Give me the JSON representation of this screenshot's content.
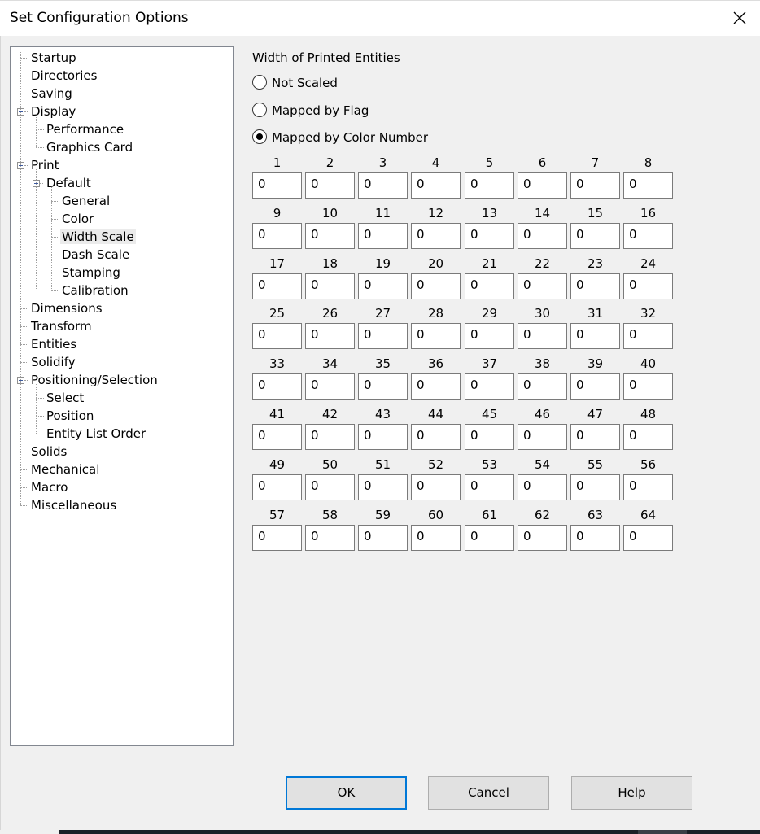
{
  "window": {
    "title": "Set Configuration Options",
    "close_icon": "close-icon"
  },
  "tree": {
    "selected": "Width Scale",
    "items": [
      {
        "label": "Startup",
        "level": 0
      },
      {
        "label": "Directories",
        "level": 0
      },
      {
        "label": "Saving",
        "level": 0
      },
      {
        "label": "Display",
        "level": 0,
        "expanded": true
      },
      {
        "label": "Performance",
        "level": 1
      },
      {
        "label": "Graphics Card",
        "level": 1
      },
      {
        "label": "Print",
        "level": 0,
        "expanded": true
      },
      {
        "label": "Default",
        "level": 1,
        "expanded": true
      },
      {
        "label": "General",
        "level": 2
      },
      {
        "label": "Color",
        "level": 2
      },
      {
        "label": "Width Scale",
        "level": 2
      },
      {
        "label": "Dash Scale",
        "level": 2
      },
      {
        "label": "Stamping",
        "level": 2
      },
      {
        "label": "Calibration",
        "level": 2
      },
      {
        "label": "Dimensions",
        "level": 0
      },
      {
        "label": "Transform",
        "level": 0
      },
      {
        "label": "Entities",
        "level": 0
      },
      {
        "label": "Solidify",
        "level": 0
      },
      {
        "label": "Positioning/Selection",
        "level": 0,
        "expanded": true
      },
      {
        "label": "Select",
        "level": 1
      },
      {
        "label": "Position",
        "level": 1
      },
      {
        "label": "Entity List Order",
        "level": 1
      },
      {
        "label": "Solids",
        "level": 0
      },
      {
        "label": "Mechanical",
        "level": 0
      },
      {
        "label": "Macro",
        "level": 0
      },
      {
        "label": "Miscellaneous",
        "level": 0
      }
    ]
  },
  "panel": {
    "group_label": "Width of Printed Entities",
    "radios": [
      {
        "label": "Not Scaled",
        "checked": false
      },
      {
        "label": "Mapped by Flag",
        "checked": false
      },
      {
        "label": "Mapped by Color Number",
        "checked": true
      }
    ],
    "color_widths": [
      {
        "n": "1",
        "v": "0"
      },
      {
        "n": "2",
        "v": "0"
      },
      {
        "n": "3",
        "v": "0"
      },
      {
        "n": "4",
        "v": "0"
      },
      {
        "n": "5",
        "v": "0"
      },
      {
        "n": "6",
        "v": "0"
      },
      {
        "n": "7",
        "v": "0"
      },
      {
        "n": "8",
        "v": "0"
      },
      {
        "n": "9",
        "v": "0"
      },
      {
        "n": "10",
        "v": "0"
      },
      {
        "n": "11",
        "v": "0"
      },
      {
        "n": "12",
        "v": "0"
      },
      {
        "n": "13",
        "v": "0"
      },
      {
        "n": "14",
        "v": "0"
      },
      {
        "n": "15",
        "v": "0"
      },
      {
        "n": "16",
        "v": "0"
      },
      {
        "n": "17",
        "v": "0"
      },
      {
        "n": "18",
        "v": "0"
      },
      {
        "n": "19",
        "v": "0"
      },
      {
        "n": "20",
        "v": "0"
      },
      {
        "n": "21",
        "v": "0"
      },
      {
        "n": "22",
        "v": "0"
      },
      {
        "n": "23",
        "v": "0"
      },
      {
        "n": "24",
        "v": "0"
      },
      {
        "n": "25",
        "v": "0"
      },
      {
        "n": "26",
        "v": "0"
      },
      {
        "n": "27",
        "v": "0"
      },
      {
        "n": "28",
        "v": "0"
      },
      {
        "n": "29",
        "v": "0"
      },
      {
        "n": "30",
        "v": "0"
      },
      {
        "n": "31",
        "v": "0"
      },
      {
        "n": "32",
        "v": "0"
      },
      {
        "n": "33",
        "v": "0"
      },
      {
        "n": "34",
        "v": "0"
      },
      {
        "n": "35",
        "v": "0"
      },
      {
        "n": "36",
        "v": "0"
      },
      {
        "n": "37",
        "v": "0"
      },
      {
        "n": "38",
        "v": "0"
      },
      {
        "n": "39",
        "v": "0"
      },
      {
        "n": "40",
        "v": "0"
      },
      {
        "n": "41",
        "v": "0"
      },
      {
        "n": "42",
        "v": "0"
      },
      {
        "n": "43",
        "v": "0"
      },
      {
        "n": "44",
        "v": "0"
      },
      {
        "n": "45",
        "v": "0"
      },
      {
        "n": "46",
        "v": "0"
      },
      {
        "n": "47",
        "v": "0"
      },
      {
        "n": "48",
        "v": "0"
      },
      {
        "n": "49",
        "v": "0"
      },
      {
        "n": "50",
        "v": "0"
      },
      {
        "n": "51",
        "v": "0"
      },
      {
        "n": "52",
        "v": "0"
      },
      {
        "n": "53",
        "v": "0"
      },
      {
        "n": "54",
        "v": "0"
      },
      {
        "n": "55",
        "v": "0"
      },
      {
        "n": "56",
        "v": "0"
      },
      {
        "n": "57",
        "v": "0"
      },
      {
        "n": "58",
        "v": "0"
      },
      {
        "n": "59",
        "v": "0"
      },
      {
        "n": "60",
        "v": "0"
      },
      {
        "n": "61",
        "v": "0"
      },
      {
        "n": "62",
        "v": "0"
      },
      {
        "n": "63",
        "v": "0"
      },
      {
        "n": "64",
        "v": "0"
      }
    ]
  },
  "buttons": {
    "ok": "OK",
    "cancel": "Cancel",
    "help": "Help"
  },
  "colors": {
    "accent": "#0078d7",
    "background": "#f0f0f0",
    "selection": "#ebebeb"
  }
}
